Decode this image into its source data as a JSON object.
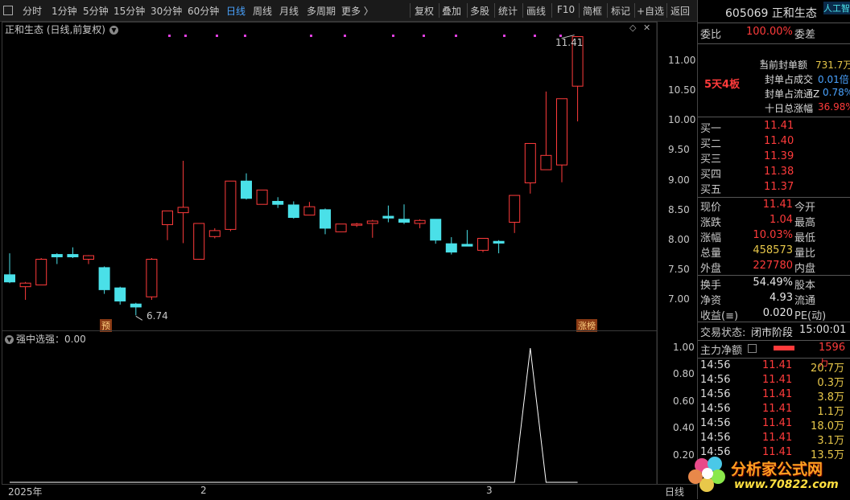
{
  "toolbar": {
    "periods": [
      "分时",
      "1分钟",
      "5分钟",
      "15分钟",
      "30分钟",
      "60分钟",
      "日线",
      "周线",
      "月线",
      "多周期",
      "更多 〉"
    ],
    "active_period": "日线",
    "tools": [
      "复权",
      "叠加",
      "多股",
      "统计",
      "画线",
      "F10",
      "简框",
      "标记",
      "+自选",
      "返回"
    ]
  },
  "kchart": {
    "title": "正和生态 (日线,前复权)",
    "high_label": "11.41",
    "low_label": "6.74",
    "marker_left": "预",
    "marker_right": "涨榜",
    "y_ticks": [
      "11.00",
      "10.50",
      "10.00",
      "9.50",
      "9.00",
      "8.50",
      "8.00",
      "7.50",
      "7.00"
    ]
  },
  "indicator": {
    "title": "强中选强：0.00",
    "y_ticks": [
      "1.00",
      "0.80",
      "0.60",
      "0.40",
      "0.20"
    ]
  },
  "x_axis": {
    "labels": [
      "2025年",
      "2",
      "3"
    ],
    "right_label": "日线"
  },
  "chart_data": [
    {
      "type": "candlestick",
      "title": "正和生态 (日线,前复权)",
      "ylim": [
        6.6,
        11.6
      ],
      "candles": [
        {
          "o": 7.42,
          "h": 7.78,
          "l": 7.28,
          "c": 7.3
        },
        {
          "o": 7.22,
          "h": 7.3,
          "l": 7.0,
          "c": 7.28
        },
        {
          "o": 7.25,
          "h": 7.7,
          "l": 7.25,
          "c": 7.68
        },
        {
          "o": 7.76,
          "h": 7.78,
          "l": 7.6,
          "c": 7.72
        },
        {
          "o": 7.76,
          "h": 7.88,
          "l": 7.7,
          "c": 7.72
        },
        {
          "o": 7.68,
          "h": 7.75,
          "l": 7.6,
          "c": 7.74
        },
        {
          "o": 7.54,
          "h": 7.56,
          "l": 7.1,
          "c": 7.17
        },
        {
          "o": 7.2,
          "h": 7.22,
          "l": 6.92,
          "c": 6.98
        },
        {
          "o": 6.93,
          "h": 6.95,
          "l": 6.74,
          "c": 6.88
        },
        {
          "o": 7.05,
          "h": 7.7,
          "l": 7.0,
          "c": 7.68
        },
        {
          "o": 8.26,
          "h": 8.49,
          "l": 8.0,
          "c": 8.49
        },
        {
          "o": 8.46,
          "h": 9.33,
          "l": 7.95,
          "c": 8.55
        },
        {
          "o": 7.68,
          "h": 8.28,
          "l": 7.68,
          "c": 8.28
        },
        {
          "o": 8.06,
          "h": 8.2,
          "l": 8.03,
          "c": 8.16
        },
        {
          "o": 8.18,
          "h": 8.99,
          "l": 8.15,
          "c": 8.99
        },
        {
          "o": 8.99,
          "h": 9.12,
          "l": 8.68,
          "c": 8.7
        },
        {
          "o": 8.6,
          "h": 8.84,
          "l": 8.6,
          "c": 8.84
        },
        {
          "o": 8.65,
          "h": 8.72,
          "l": 8.54,
          "c": 8.6
        },
        {
          "o": 8.59,
          "h": 8.65,
          "l": 8.36,
          "c": 8.38
        },
        {
          "o": 8.42,
          "h": 8.64,
          "l": 8.42,
          "c": 8.56
        },
        {
          "o": 8.51,
          "h": 8.53,
          "l": 8.1,
          "c": 8.2
        },
        {
          "o": 8.14,
          "h": 8.27,
          "l": 8.14,
          "c": 8.27
        },
        {
          "o": 8.25,
          "h": 8.29,
          "l": 8.22,
          "c": 8.27
        },
        {
          "o": 8.28,
          "h": 8.34,
          "l": 8.04,
          "c": 8.32
        },
        {
          "o": 8.4,
          "h": 8.58,
          "l": 8.3,
          "c": 8.37
        },
        {
          "o": 8.35,
          "h": 8.6,
          "l": 8.27,
          "c": 8.3
        },
        {
          "o": 8.28,
          "h": 8.35,
          "l": 8.2,
          "c": 8.33
        },
        {
          "o": 8.35,
          "h": 8.35,
          "l": 7.94,
          "c": 8.0
        },
        {
          "o": 7.94,
          "h": 8.05,
          "l": 7.76,
          "c": 7.8
        },
        {
          "o": 7.93,
          "h": 8.17,
          "l": 7.9,
          "c": 7.9
        },
        {
          "o": 7.83,
          "h": 8.03,
          "l": 7.8,
          "c": 8.03
        },
        {
          "o": 7.98,
          "h": 8.0,
          "l": 7.78,
          "c": 7.95
        },
        {
          "o": 8.3,
          "h": 8.75,
          "l": 8.12,
          "c": 8.75
        },
        {
          "o": 8.96,
          "h": 9.62,
          "l": 8.78,
          "c": 9.62
        },
        {
          "o": 9.18,
          "h": 10.49,
          "l": 9.18,
          "c": 9.42
        },
        {
          "o": 9.26,
          "h": 10.37,
          "l": 8.97,
          "c": 10.37
        },
        {
          "o": 10.58,
          "h": 11.41,
          "l": 9.99,
          "c": 11.41
        }
      ]
    },
    {
      "type": "line",
      "title": "强中选强：0.00",
      "ylim": [
        0,
        1.1
      ],
      "values": [
        0,
        0,
        0,
        0,
        0,
        0,
        0,
        0,
        0,
        0,
        0,
        0,
        0,
        0,
        0,
        0,
        0,
        0,
        0,
        0,
        0,
        0,
        0,
        0,
        0,
        0,
        0,
        0,
        0,
        0,
        0,
        0,
        0,
        1,
        0,
        0,
        0
      ]
    }
  ],
  "quote": {
    "code_name": "605069 正和生态",
    "ai_label": "人工智",
    "weibi_label": "委比",
    "weibi": "100.00%",
    "weicha_label": "委差",
    "board": "5天4板",
    "seal": [
      {
        "label": "当前封单额",
        "value": "731.7万"
      },
      {
        "label": "封单占成交",
        "value": "0.01倍"
      },
      {
        "label": "封单占流通Z",
        "value": "0.78%"
      },
      {
        "label": "十日总涨幅",
        "value": "36.98%"
      }
    ],
    "bids": [
      {
        "label": "买一",
        "price": "11.41"
      },
      {
        "label": "买二",
        "price": "11.40"
      },
      {
        "label": "买三",
        "price": "11.39"
      },
      {
        "label": "买四",
        "price": "11.38"
      },
      {
        "label": "买五",
        "price": "11.37"
      }
    ],
    "stats": [
      {
        "label": "现价",
        "value": "11.41",
        "right": "今开"
      },
      {
        "label": "涨跌",
        "value": "1.04",
        "right": "最高"
      },
      {
        "label": "涨幅",
        "value": "10.03%",
        "right": "最低"
      },
      {
        "label": "总量",
        "value": "458573",
        "right": "量比"
      },
      {
        "label": "外盘",
        "value": "227780",
        "right": "内盘"
      }
    ],
    "stats2": [
      {
        "label": "换手",
        "value": "54.49%",
        "right": "股本"
      },
      {
        "label": "净资",
        "value": "4.93",
        "right": "流通"
      },
      {
        "label": "收益(≡)",
        "value": "0.020",
        "right": "PE(动)"
      }
    ],
    "trade_status_label": "交易状态:",
    "trade_status": "闭市阶段",
    "trade_time": "15:00:01",
    "main_net_label": "主力净额",
    "main_net_value": "1596万",
    "trades": [
      {
        "time": "14:56",
        "price": "11.41",
        "vol": "20.7万"
      },
      {
        "time": "14:56",
        "price": "11.41",
        "vol": "0.3万"
      },
      {
        "time": "14:56",
        "price": "11.41",
        "vol": "3.8万"
      },
      {
        "time": "14:56",
        "price": "11.41",
        "vol": "1.1万"
      },
      {
        "time": "14:56",
        "price": "11.41",
        "vol": "18.0万"
      },
      {
        "time": "14:56",
        "price": "11.41",
        "vol": "3.1万"
      },
      {
        "time": "14:56",
        "price": "11.41",
        "vol": "13.5万"
      }
    ]
  },
  "watermark": {
    "main": "分析家公式网",
    "url": "www.70822.com"
  },
  "colors": {
    "up": "#ff3b3b",
    "down": "#4ae0e8",
    "bg": "#000000",
    "active": "#4aa3ff"
  }
}
